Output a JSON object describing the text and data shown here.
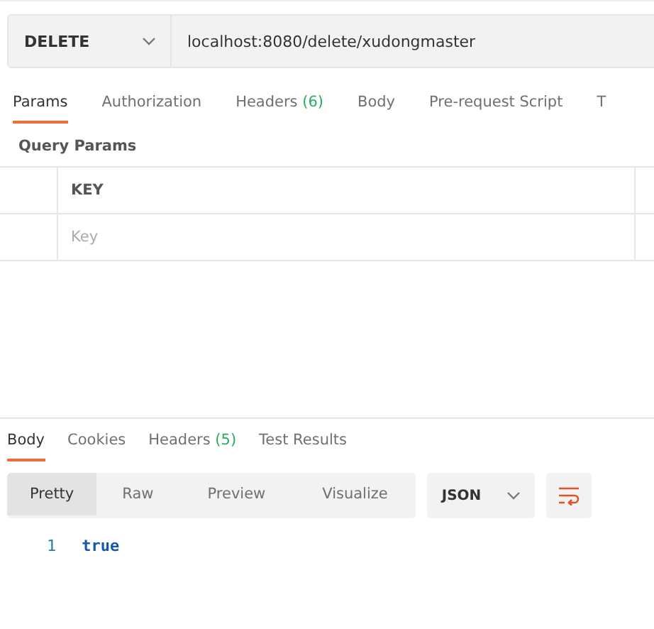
{
  "request": {
    "method": "DELETE",
    "url": "localhost:8080/delete/xudongmaster"
  },
  "request_tabs": [
    {
      "label": "Params",
      "selected": true
    },
    {
      "label": "Authorization",
      "selected": false
    },
    {
      "label": "Headers",
      "count": "(6)",
      "selected": false
    },
    {
      "label": "Body",
      "selected": false
    },
    {
      "label": "Pre-request Script",
      "selected": false
    },
    {
      "label": "T",
      "selected": false
    }
  ],
  "query_params": {
    "title": "Query Params",
    "columns": [
      "KEY"
    ],
    "placeholders": [
      "Key"
    ]
  },
  "response_tabs": [
    {
      "label": "Body",
      "selected": true
    },
    {
      "label": "Cookies",
      "selected": false
    },
    {
      "label": "Headers",
      "count": "(5)",
      "selected": false
    },
    {
      "label": "Test Results",
      "selected": false
    }
  ],
  "view_modes": [
    {
      "label": "Pretty",
      "selected": true
    },
    {
      "label": "Raw",
      "selected": false
    },
    {
      "label": "Preview",
      "selected": false
    },
    {
      "label": "Visualize",
      "selected": false
    }
  ],
  "format": "JSON",
  "lines": [
    {
      "number": "1",
      "text": "true"
    }
  ]
}
